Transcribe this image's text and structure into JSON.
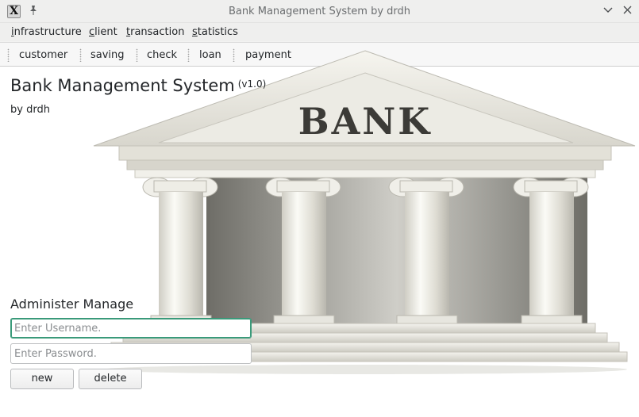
{
  "window": {
    "title": "Bank Management System by drdh",
    "app_icon_glyph": "X"
  },
  "menubar": {
    "items": [
      {
        "first": "i",
        "rest": "nfrastructure"
      },
      {
        "first": "c",
        "rest": "lient"
      },
      {
        "first": "t",
        "rest": "ransaction"
      },
      {
        "first": "s",
        "rest": "tatistics"
      }
    ]
  },
  "toolbar": {
    "items": [
      "customer",
      "saving",
      "check",
      "loan",
      "payment"
    ]
  },
  "main": {
    "heading": "Bank Management System",
    "version": "(v1.0)",
    "author": "by drdh",
    "image_label": "BANK",
    "admin": {
      "title": "Administer Manage",
      "username_placeholder": "Enter Username.",
      "password_placeholder": "Enter Password.",
      "new_label": "new",
      "delete_label": "delete"
    }
  },
  "icons": {
    "app": "x-window-icon",
    "pin": "pin-icon",
    "minimize": "chevron-down-icon",
    "close": "close-icon"
  },
  "colors": {
    "focus_accent": "#3a9a7a",
    "window_bg": "#efefee",
    "content_bg": "#ffffff"
  }
}
